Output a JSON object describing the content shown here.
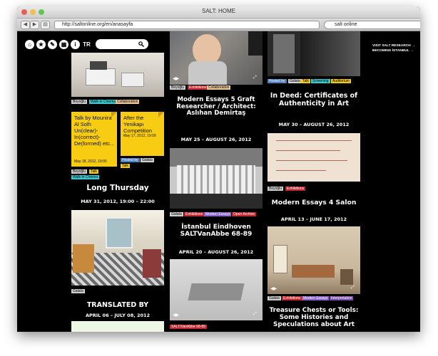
{
  "browser": {
    "title": "SALT: HOME",
    "url": "http://saltonline.org/en/anasayfa",
    "search_value": "salt online",
    "back_icon": "◀",
    "forward_icon": "▶",
    "traffic_colors": [
      "#ec5f59",
      "#f4be4f",
      "#62c655"
    ]
  },
  "site_nav": {
    "icons": [
      "home-icon",
      "star-icon",
      "pin-icon",
      "calendar-icon",
      "info-icon"
    ],
    "icon_glyphs": [
      "⌂",
      "★",
      "✎",
      "▦",
      "i"
    ],
    "language": "TR"
  },
  "right_links": [
    "VISIT SALT RESEARCH →",
    "BECOMING İSTANBUL →"
  ],
  "col1": {
    "tags1": [
      "Beyoğlu",
      "Walk-in Cinema",
      "Collaboration"
    ],
    "card1": {
      "text": "Talk by Mounira Al Solh Un(clear)-In(correct)-De(formed) etc...",
      "date": "May 18, 2012, 19:00"
    },
    "card2": {
      "text": "After the Yenikapı Competition",
      "date": "May 17, 2012, 19:00"
    },
    "card1_tags": [
      "Beyoğlu",
      "Talk",
      "Walk-in Cinema"
    ],
    "card2_tags": [
      "Hosted by",
      "Galata",
      "Talk"
    ],
    "event": {
      "title": "Long Thursday",
      "date": "MAY 31, 2012, 19:00 – 22:00"
    },
    "tag_galata": "Galata",
    "translated": {
      "title": "TRANSLATED BY",
      "date": "APRIL 06 – JULY 08, 2012"
    }
  },
  "col2": {
    "tags1": [
      "Beyoğlu",
      "Exhibitions",
      "Collaboration"
    ],
    "event1": {
      "title": "Modern Essays 5 Graft Researcher / Architect: Aslıhan Demirtaş",
      "date": "MAY 25 – AUGUST 26, 2012"
    },
    "tags2": [
      "Galata",
      "Exhibitions",
      "Modern Essays",
      "Open Archive"
    ],
    "event2": {
      "title": "İstanbul Eindhoven SALTVanAbbe 68-89",
      "date": "APRIL 20 – AUGUST 26, 2012"
    },
    "tags3": [
      "SALT/VanAbbe 68-89"
    ]
  },
  "col3": {
    "tags1": [
      "Hosted by",
      "Galata",
      "Talk",
      "Screening",
      "Auditorium"
    ],
    "event1": {
      "title": "In Deed: Certificates of Authenticity in Art",
      "date": "MAY 30 – AUGUST 26, 2012"
    },
    "tags2": [
      "Beyoğlu",
      "Exhibitions"
    ],
    "event2": {
      "title": "Modern Essays 4 Salon",
      "date": "APRIL 13 – JUNE 17, 2012"
    },
    "tags3": [
      "Galata",
      "Exhibitions",
      "Modern Essays",
      "Interpretation"
    ],
    "event3": {
      "title": "Treasure Chests or Tools: Some Histories and Speculations about Art"
    }
  },
  "controls": {
    "prev": "◀",
    "next": "▶",
    "expand": "⤢"
  }
}
